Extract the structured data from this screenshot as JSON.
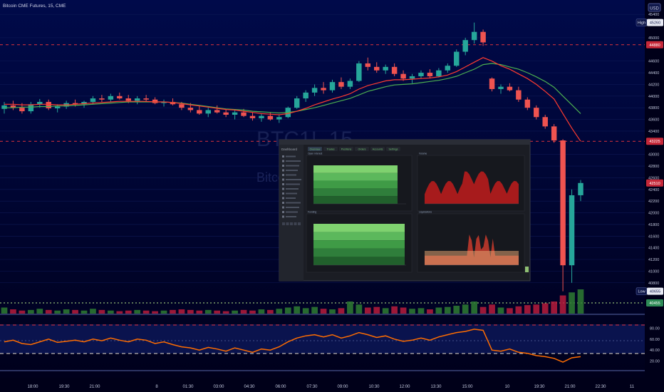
{
  "header": {
    "symbol_label": "Bitcoin CME Futures, 15, CME",
    "currency": "USD"
  },
  "watermark": {
    "ticker": "BTC1!, 15",
    "name": "Bitcoin CME Futures"
  },
  "price_axis": {
    "ticks": [
      "45400",
      "45000",
      "44600",
      "44400",
      "44200",
      "44000",
      "43800",
      "43600",
      "43400",
      "43000",
      "42800",
      "42600",
      "42400",
      "42200",
      "42000",
      "41800",
      "41600",
      "41400",
      "41200",
      "41000",
      "40800"
    ],
    "labels": {
      "high_tag": "High",
      "high_value": "45260",
      "level_top": "44880",
      "level_mid": "43225",
      "last": "42510",
      "low_tag": "Low",
      "low_value": "40655",
      "level_bottom": "40455"
    }
  },
  "rsi_axis": {
    "ticks": [
      "80.00",
      "60.00",
      "40.00",
      "20.00"
    ]
  },
  "time_axis": {
    "ticks": [
      "18:00",
      "19:30",
      "21:00",
      "8",
      "01:30",
      "03:00",
      "04:30",
      "06:00",
      "07:30",
      "09:00",
      "10:30",
      "12:00",
      "13:30",
      "15:00",
      "10",
      "19:30",
      "21:00",
      "22:30",
      "11"
    ]
  },
  "inset": {
    "tab_title": "Dashboard",
    "tabs": [
      "Overview",
      "Trades",
      "Positions",
      "Orders",
      "Accounts",
      "Settings"
    ],
    "panels": [
      "Open interest",
      "Volume",
      "Funding",
      "Liquidations"
    ]
  },
  "colors": {
    "up": "#26a69a",
    "down": "#ef5350",
    "ema_fast": "#ff3b2f",
    "ema_slow": "#4caf50",
    "rsi": "#ff6d00",
    "level": "#e0323c"
  },
  "chart_data": {
    "type": "candlestick",
    "ylim": [
      40455,
      45500
    ],
    "rsi_ylim": [
      0,
      100
    ],
    "candles": [
      {
        "t": "18:00",
        "o": 43780,
        "h": 43900,
        "l": 43700,
        "c": 43840
      },
      {
        "t": "18:15",
        "o": 43840,
        "h": 43920,
        "l": 43760,
        "c": 43800
      },
      {
        "t": "18:30",
        "o": 43800,
        "h": 43880,
        "l": 43700,
        "c": 43740
      },
      {
        "t": "18:45",
        "o": 43740,
        "h": 43900,
        "l": 43700,
        "c": 43860
      },
      {
        "t": "19:00",
        "o": 43860,
        "h": 43950,
        "l": 43800,
        "c": 43900
      },
      {
        "t": "19:15",
        "o": 43900,
        "h": 43940,
        "l": 43760,
        "c": 43790
      },
      {
        "t": "19:30",
        "o": 43790,
        "h": 43860,
        "l": 43720,
        "c": 43820
      },
      {
        "t": "19:45",
        "o": 43820,
        "h": 43920,
        "l": 43780,
        "c": 43880
      },
      {
        "t": "20:00",
        "o": 43880,
        "h": 43940,
        "l": 43820,
        "c": 43860
      },
      {
        "t": "20:15",
        "o": 43860,
        "h": 43920,
        "l": 43800,
        "c": 43900
      },
      {
        "t": "20:30",
        "o": 43900,
        "h": 44000,
        "l": 43860,
        "c": 43960
      },
      {
        "t": "20:45",
        "o": 43960,
        "h": 44020,
        "l": 43900,
        "c": 43940
      },
      {
        "t": "21:00",
        "o": 43940,
        "h": 44040,
        "l": 43900,
        "c": 44000
      },
      {
        "t": "21:15",
        "o": 44000,
        "h": 44060,
        "l": 43940,
        "c": 43960
      },
      {
        "t": "21:30",
        "o": 43960,
        "h": 44020,
        "l": 43880,
        "c": 43920
      },
      {
        "t": "21:45",
        "o": 43920,
        "h": 44000,
        "l": 43860,
        "c": 43960
      },
      {
        "t": "22:00",
        "o": 43960,
        "h": 44020,
        "l": 43900,
        "c": 43940
      },
      {
        "t": "22:15",
        "o": 43940,
        "h": 43980,
        "l": 43860,
        "c": 43880
      },
      {
        "t": "22:30",
        "o": 43880,
        "h": 43940,
        "l": 43820,
        "c": 43900
      },
      {
        "t": "23:00",
        "o": 43900,
        "h": 43960,
        "l": 43840,
        "c": 43860
      },
      {
        "t": "00:00",
        "o": 43860,
        "h": 43900,
        "l": 43760,
        "c": 43800
      },
      {
        "t": "00:30",
        "o": 43800,
        "h": 43880,
        "l": 43720,
        "c": 43760
      },
      {
        "t": "01:00",
        "o": 43760,
        "h": 43840,
        "l": 43680,
        "c": 43700
      },
      {
        "t": "01:30",
        "o": 43700,
        "h": 43800,
        "l": 43640,
        "c": 43760
      },
      {
        "t": "02:00",
        "o": 43760,
        "h": 43840,
        "l": 43700,
        "c": 43720
      },
      {
        "t": "02:30",
        "o": 43720,
        "h": 43780,
        "l": 43640,
        "c": 43680
      },
      {
        "t": "03:00",
        "o": 43680,
        "h": 43760,
        "l": 43600,
        "c": 43720
      },
      {
        "t": "03:30",
        "o": 43720,
        "h": 43780,
        "l": 43640,
        "c": 43660
      },
      {
        "t": "04:00",
        "o": 43660,
        "h": 43720,
        "l": 43580,
        "c": 43620
      },
      {
        "t": "04:30",
        "o": 43620,
        "h": 43700,
        "l": 43560,
        "c": 43660
      },
      {
        "t": "05:00",
        "o": 43660,
        "h": 43720,
        "l": 43580,
        "c": 43600
      },
      {
        "t": "05:30",
        "o": 43600,
        "h": 43680,
        "l": 43540,
        "c": 43640
      },
      {
        "t": "06:00",
        "o": 43640,
        "h": 43820,
        "l": 43620,
        "c": 43800
      },
      {
        "t": "06:30",
        "o": 43800,
        "h": 44000,
        "l": 43780,
        "c": 43960
      },
      {
        "t": "07:00",
        "o": 43960,
        "h": 44100,
        "l": 43900,
        "c": 44060
      },
      {
        "t": "07:30",
        "o": 44060,
        "h": 44200,
        "l": 44000,
        "c": 44140
      },
      {
        "t": "08:00",
        "o": 44140,
        "h": 44240,
        "l": 44040,
        "c": 44100
      },
      {
        "t": "08:30",
        "o": 44100,
        "h": 44280,
        "l": 44060,
        "c": 44240
      },
      {
        "t": "09:00",
        "o": 44240,
        "h": 44320,
        "l": 44120,
        "c": 44160
      },
      {
        "t": "09:30",
        "o": 44160,
        "h": 44300,
        "l": 44120,
        "c": 44260
      },
      {
        "t": "10:00",
        "o": 44260,
        "h": 44600,
        "l": 44240,
        "c": 44560
      },
      {
        "t": "10:30",
        "o": 44560,
        "h": 44660,
        "l": 44440,
        "c": 44500
      },
      {
        "t": "11:00",
        "o": 44500,
        "h": 44580,
        "l": 44400,
        "c": 44440
      },
      {
        "t": "11:30",
        "o": 44440,
        "h": 44540,
        "l": 44380,
        "c": 44500
      },
      {
        "t": "12:00",
        "o": 44500,
        "h": 44560,
        "l": 44340,
        "c": 44380
      },
      {
        "t": "12:30",
        "o": 44380,
        "h": 44440,
        "l": 44260,
        "c": 44300
      },
      {
        "t": "13:00",
        "o": 44300,
        "h": 44380,
        "l": 44220,
        "c": 44340
      },
      {
        "t": "13:30",
        "o": 44340,
        "h": 44440,
        "l": 44300,
        "c": 44400
      },
      {
        "t": "14:00",
        "o": 44400,
        "h": 44460,
        "l": 44300,
        "c": 44340
      },
      {
        "t": "14:30",
        "o": 44340,
        "h": 44480,
        "l": 44320,
        "c": 44440
      },
      {
        "t": "15:00",
        "o": 44440,
        "h": 44560,
        "l": 44400,
        "c": 44520
      },
      {
        "t": "15:30",
        "o": 44520,
        "h": 44800,
        "l": 44500,
        "c": 44760
      },
      {
        "t": "16:00",
        "o": 44760,
        "h": 45000,
        "l": 44700,
        "c": 44960
      },
      {
        "t": "16:30",
        "o": 44960,
        "h": 45260,
        "l": 44900,
        "c": 45100
      },
      {
        "t": "17:00",
        "o": 45100,
        "h": 45140,
        "l": 44860,
        "c": 44920
      },
      {
        "t": "18:00",
        "o": 44300,
        "h": 44320,
        "l": 44080,
        "c": 44120
      },
      {
        "t": "18:15",
        "o": 44120,
        "h": 44200,
        "l": 44040,
        "c": 44160
      },
      {
        "t": "18:30",
        "o": 44160,
        "h": 44220,
        "l": 44080,
        "c": 44100
      },
      {
        "t": "18:45",
        "o": 44100,
        "h": 44160,
        "l": 43900,
        "c": 43940
      },
      {
        "t": "19:00",
        "o": 43940,
        "h": 43980,
        "l": 43760,
        "c": 43800
      },
      {
        "t": "19:15",
        "o": 43800,
        "h": 43840,
        "l": 43600,
        "c": 43640
      },
      {
        "t": "19:30",
        "o": 43640,
        "h": 43680,
        "l": 43440,
        "c": 43480
      },
      {
        "t": "19:45",
        "o": 43480,
        "h": 43520,
        "l": 43200,
        "c": 43240
      },
      {
        "t": "20:00",
        "o": 43240,
        "h": 43260,
        "l": 40655,
        "c": 41100
      },
      {
        "t": "20:15",
        "o": 41100,
        "h": 42400,
        "l": 40800,
        "c": 42300
      },
      {
        "t": "20:30",
        "o": 42300,
        "h": 42560,
        "l": 42200,
        "c": 42510
      }
    ],
    "ema_fast": [
      43860,
      43860,
      43850,
      43850,
      43860,
      43860,
      43850,
      43850,
      43860,
      43870,
      43880,
      43890,
      43900,
      43910,
      43910,
      43910,
      43910,
      43900,
      43900,
      43890,
      43870,
      43850,
      43830,
      43810,
      43790,
      43770,
      43760,
      43740,
      43720,
      43700,
      43690,
      43680,
      43700,
      43740,
      43790,
      43850,
      43900,
      43950,
      43990,
      44040,
      44120,
      44180,
      44220,
      44260,
      44280,
      44280,
      44290,
      44300,
      44310,
      44330,
      44360,
      44420,
      44500,
      44580,
      44660,
      44600,
      44520,
      44460,
      44380,
      44300,
      44200,
      44080,
      43950,
      43700,
      43450,
      43225
    ],
    "ema_slow": [
      43800,
      43800,
      43810,
      43810,
      43820,
      43820,
      43830,
      43830,
      43840,
      43850,
      43860,
      43870,
      43880,
      43890,
      43900,
      43900,
      43900,
      43900,
      43900,
      43890,
      43880,
      43860,
      43840,
      43820,
      43800,
      43780,
      43770,
      43760,
      43740,
      43730,
      43720,
      43710,
      43720,
      43740,
      43770,
      43800,
      43840,
      43880,
      43920,
      43960,
      44020,
      44080,
      44120,
      44160,
      44190,
      44200,
      44210,
      44230,
      44250,
      44270,
      44300,
      44340,
      44400,
      44460,
      44540,
      44560,
      44540,
      44500,
      44460,
      44400,
      44330,
      44250,
      44150,
      44000,
      43850,
      43700
    ],
    "volume": [
      20,
      14,
      10,
      12,
      16,
      12,
      10,
      14,
      12,
      10,
      16,
      12,
      10,
      8,
      10,
      12,
      10,
      8,
      10,
      12,
      14,
      12,
      10,
      12,
      10,
      8,
      10,
      12,
      10,
      14,
      12,
      16,
      20,
      24,
      18,
      22,
      16,
      14,
      18,
      40,
      30,
      20,
      22,
      18,
      24,
      20,
      16,
      18,
      14,
      20,
      22,
      26,
      30,
      40,
      22,
      30,
      20,
      18,
      24,
      28,
      30,
      34,
      40,
      60,
      70,
      80
    ],
    "rsi": [
      55,
      58,
      52,
      50,
      55,
      60,
      54,
      56,
      58,
      55,
      60,
      57,
      62,
      58,
      55,
      60,
      58,
      52,
      55,
      50,
      46,
      44,
      40,
      45,
      42,
      38,
      44,
      40,
      36,
      42,
      40,
      46,
      55,
      62,
      66,
      68,
      64,
      68,
      62,
      66,
      72,
      68,
      63,
      66,
      60,
      56,
      58,
      62,
      58,
      64,
      68,
      72,
      74,
      78,
      76,
      40,
      38,
      42,
      36,
      34,
      30,
      28,
      25,
      18,
      26,
      28
    ]
  }
}
